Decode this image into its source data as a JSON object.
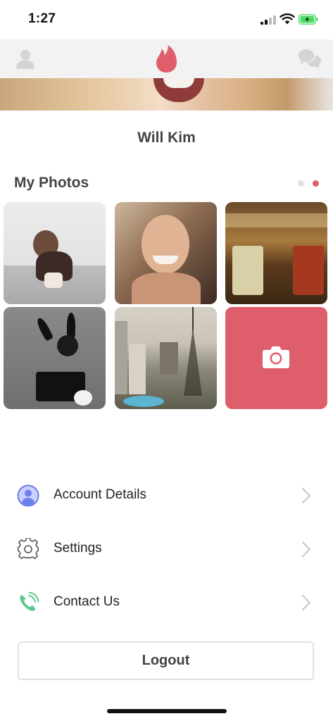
{
  "status_bar": {
    "time": "1:27"
  },
  "header": {
    "left_icon": "profile-icon",
    "center_icon": "flame-logo-icon",
    "right_icon": "chat-bubbles-icon"
  },
  "profile": {
    "name": "Will Kim"
  },
  "photos_section": {
    "title": "My Photos",
    "page_dots": 2,
    "active_page": 2,
    "add_photo_icon": "camera-icon"
  },
  "menu": [
    {
      "label": "Account Details",
      "icon": "account-icon"
    },
    {
      "label": "Settings",
      "icon": "gear-icon"
    },
    {
      "label": "Contact Us",
      "icon": "phone-icon"
    }
  ],
  "logout_label": "Logout",
  "colors": {
    "accent": "#df5e6b",
    "header_bg": "#f2f2f2",
    "account_icon": "#6b7fe8",
    "phone_icon": "#5cc889",
    "dot_inactive": "#e0e0e0",
    "dot_active": "#df5e6b"
  }
}
